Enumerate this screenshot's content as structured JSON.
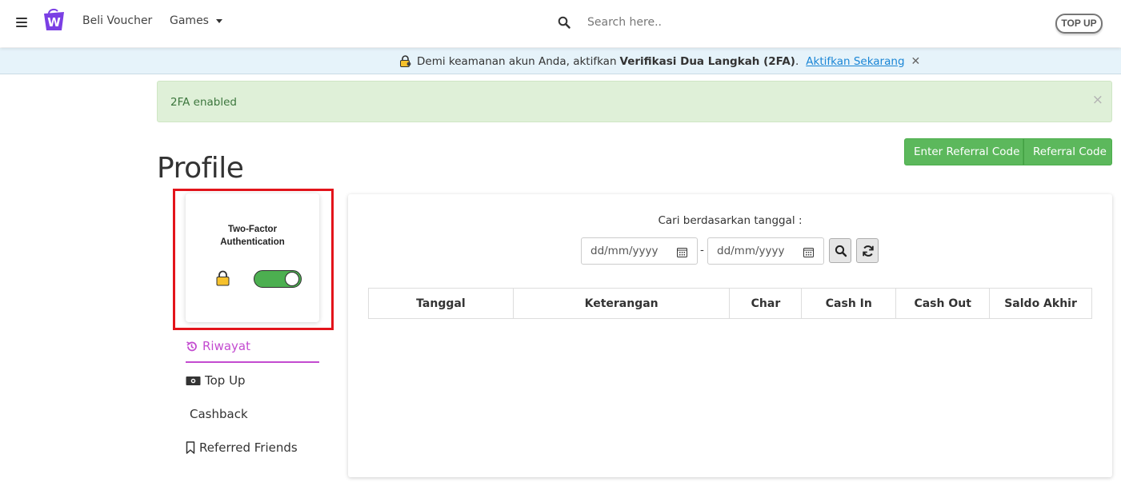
{
  "header": {
    "nav": [
      "Beli Voucher",
      "Games"
    ],
    "search_placeholder": "Search here..",
    "topup_label": "TOP UP",
    "logo_letter": "W",
    "logo_color": "#7b3fe4"
  },
  "banner": {
    "text": "Demi keamanan akun Anda, aktifkan",
    "bold": "Verifikasi Dua Langkah (2FA)",
    "period": ".",
    "link": "Aktifkan Sekarang",
    "close": "✕"
  },
  "alert": {
    "text": "2FA enabled",
    "close": "×"
  },
  "profile": {
    "title": "Profile",
    "buttons": [
      "Enter Referral Code",
      "Referral Code"
    ]
  },
  "twofa_card": {
    "title_line1": "Two-Factor",
    "title_line2": "Authentication",
    "enabled": true,
    "toggle_color": "#4caf50"
  },
  "menu": [
    {
      "label": "Riwayat",
      "icon": "history-icon",
      "active": true
    },
    {
      "label": "Top Up",
      "icon": "money-icon"
    },
    {
      "label": "Cashback",
      "icon": ""
    },
    {
      "label": "Referred Friends",
      "icon": "bookmark-icon"
    }
  ],
  "history": {
    "filter_label": "Cari berdasarkan tanggal :",
    "date_from_placeholder": "dd/mm/yyyy",
    "date_to_placeholder": "dd/mm/yyyy",
    "separator": "-",
    "columns": [
      "Tanggal",
      "Keterangan",
      "Char",
      "Cash In",
      "Cash Out",
      "Saldo Akhir"
    ],
    "rows": []
  },
  "colors": {
    "accent_purple": "#c34bd0",
    "success_green": "#5cb85c",
    "highlight_red": "#e3141b",
    "banner_bg": "#e6f3fa",
    "alert_bg": "#dff0d8"
  }
}
